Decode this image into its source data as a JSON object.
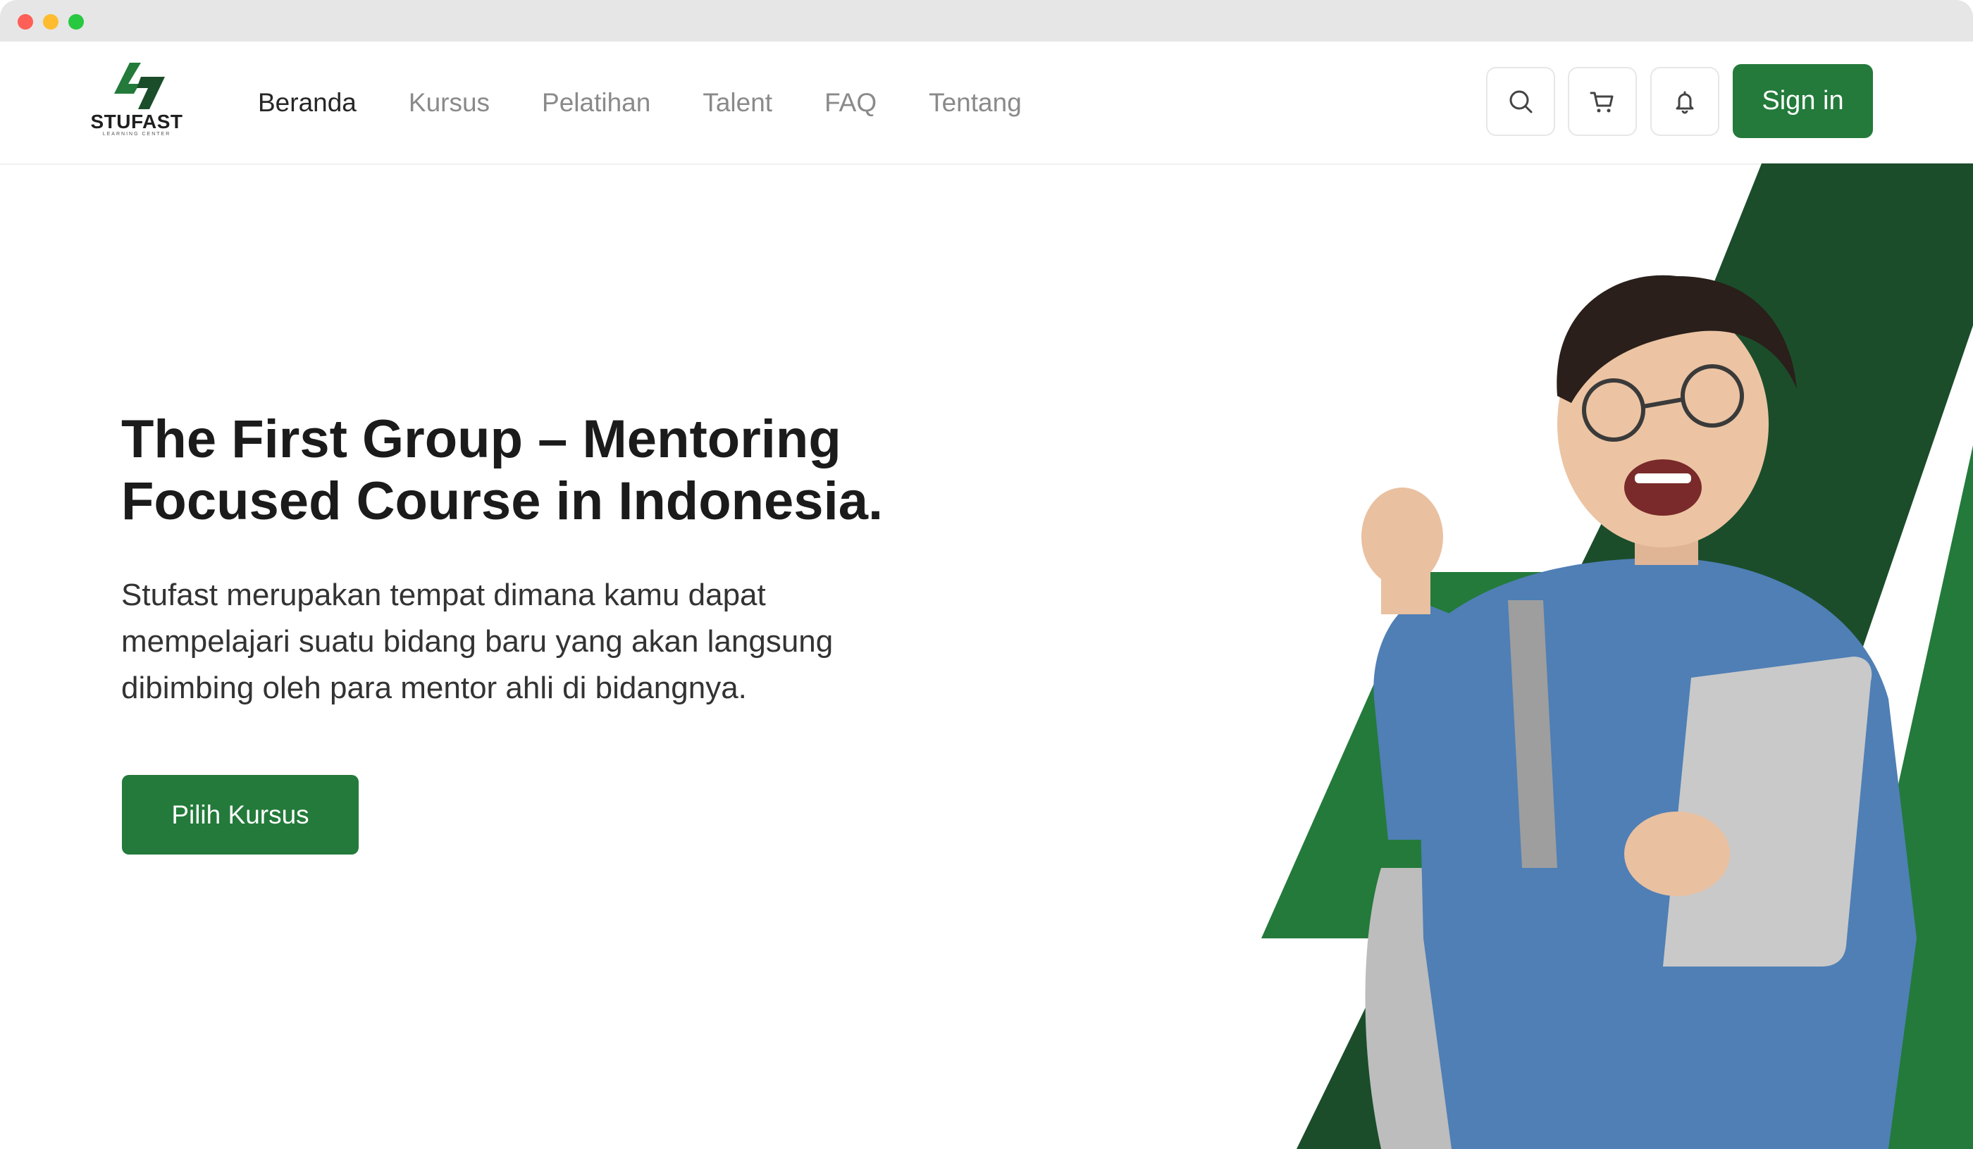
{
  "brand": {
    "name": "STUFAST",
    "tagline": "LEARNING CENTER",
    "primary_color": "#237a3a",
    "dark_green": "#1b4d2b"
  },
  "nav": {
    "links": [
      {
        "label": "Beranda",
        "active": true
      },
      {
        "label": "Kursus",
        "active": false
      },
      {
        "label": "Pelatihan",
        "active": false
      },
      {
        "label": "Talent",
        "active": false
      },
      {
        "label": "FAQ",
        "active": false
      },
      {
        "label": "Tentang",
        "active": false
      }
    ],
    "icons": [
      "search-icon",
      "cart-icon",
      "bell-icon"
    ],
    "signin_label": "Sign in"
  },
  "hero": {
    "title": "The First Group – Mentoring Focused Course in Indonesia.",
    "description": "Stufast merupakan tempat dimana kamu dapat mempelajari suatu bidang baru yang akan langsung dibimbing oleh para mentor ahli di bidangnya.",
    "cta_label": "Pilih Kursus"
  }
}
